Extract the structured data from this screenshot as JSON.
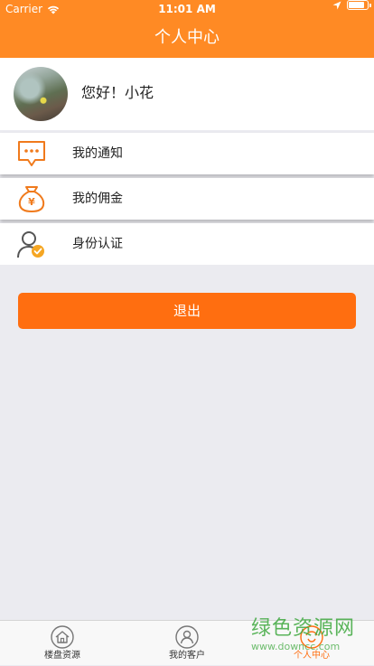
{
  "status_bar": {
    "carrier": "Carrier",
    "time": "11:01 AM"
  },
  "header": {
    "title": "个人中心",
    "color": "#ff8a24"
  },
  "profile": {
    "greeting": "您好！小花"
  },
  "menu": {
    "items": [
      {
        "label": "我的通知",
        "icon": "notification-bubble-icon"
      },
      {
        "label": "我的佣金",
        "icon": "money-bag-icon"
      },
      {
        "label": "身份认证",
        "icon": "verified-user-icon"
      }
    ]
  },
  "actions": {
    "logout_label": "退出",
    "accent": "#ff6e10"
  },
  "tabbar": {
    "tabs": [
      {
        "label": "楼盘资源",
        "icon": "house-icon",
        "active": false
      },
      {
        "label": "我的客户",
        "icon": "customer-icon",
        "active": false
      },
      {
        "label": "个人中心",
        "icon": "profile-icon",
        "active": true
      }
    ]
  },
  "watermark": {
    "line1": "绿色资源网",
    "line2": "www.downcc.com"
  }
}
